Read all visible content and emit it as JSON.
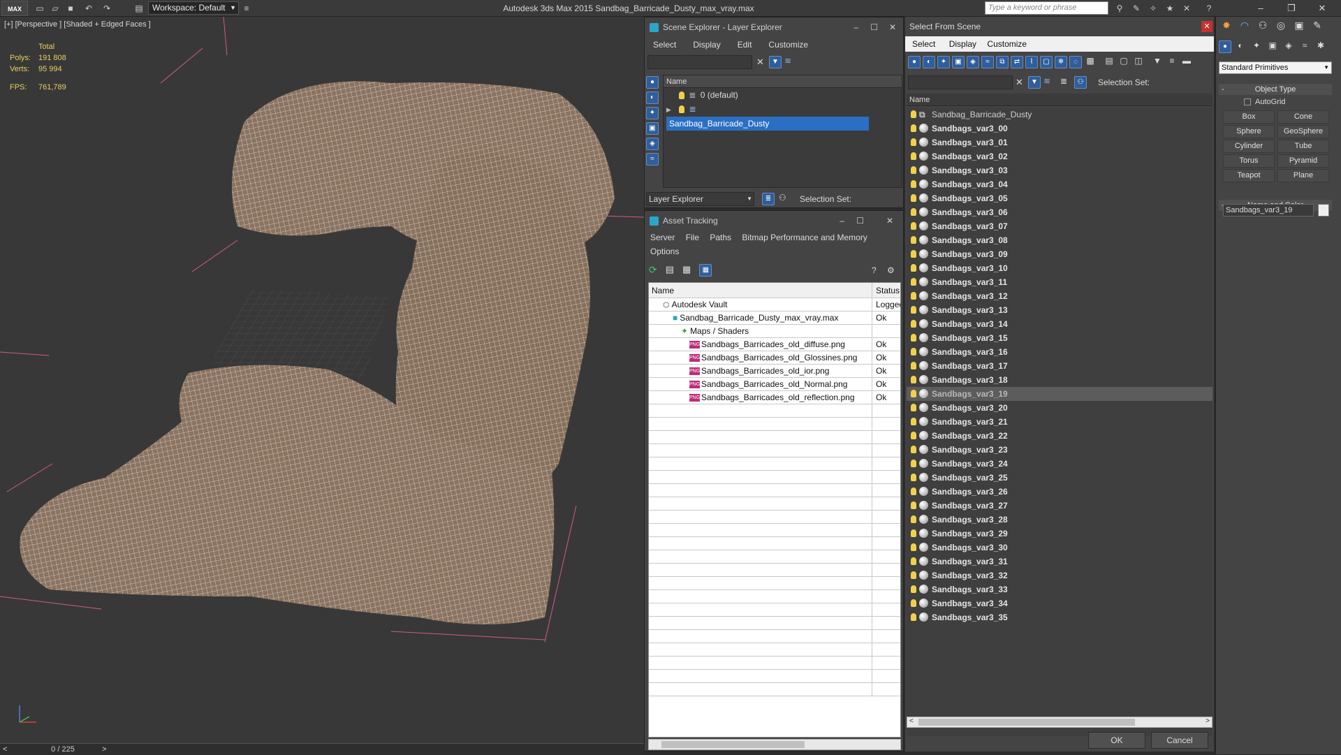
{
  "app": {
    "logo": "MAX",
    "title": "Autodesk 3ds Max  2015    Sandbag_Barricade_Dusty_max_vray.max",
    "workspace": "Workspace: Default",
    "search_placeholder": "Type a keyword or phrase"
  },
  "viewport": {
    "label": "[+] [Perspective ] [Shaded + Edged Faces ]",
    "stats": {
      "total_label": "Total",
      "polys_label": "Polys:",
      "polys": "191 808",
      "verts_label": "Verts:",
      "verts": "95 994",
      "fps_label": "FPS:",
      "fps": "761,789"
    },
    "timeline": {
      "frames": "0 / 225"
    }
  },
  "scene_explorer": {
    "title": "Scene Explorer - Layer Explorer",
    "menu": [
      "Select",
      "Display",
      "Edit",
      "Customize"
    ],
    "column_name": "Name",
    "layers": [
      "0 (default)",
      "Sandbag_Barricade_Dusty"
    ],
    "footer_label": "Layer Explorer",
    "selection_set_label": "Selection Set:"
  },
  "asset_tracking": {
    "title": "Asset Tracking",
    "menu": [
      "Server",
      "File",
      "Paths",
      "Bitmap Performance and Memory",
      "Options"
    ],
    "col_name": "Name",
    "col_status": "Status",
    "rows": [
      {
        "name": "Autodesk Vault",
        "status": "Logged",
        "indent": 0
      },
      {
        "name": "Sandbag_Barricade_Dusty_max_vray.max",
        "status": "Ok",
        "indent": 1
      },
      {
        "name": "Maps / Shaders",
        "status": "",
        "indent": 2
      },
      {
        "name": "Sandbags_Barricades_old_diffuse.png",
        "status": "Ok",
        "indent": 3
      },
      {
        "name": "Sandbags_Barricades_old_Glossines.png",
        "status": "Ok",
        "indent": 3
      },
      {
        "name": "Sandbags_Barricades_old_ior.png",
        "status": "Ok",
        "indent": 3
      },
      {
        "name": "Sandbags_Barricades_old_Normal.png",
        "status": "Ok",
        "indent": 3
      },
      {
        "name": "Sandbags_Barricades_old_reflection.png",
        "status": "Ok",
        "indent": 3
      }
    ],
    "png_tag": "PNG"
  },
  "select_from_scene": {
    "title": "Select From Scene",
    "menu": [
      "Select",
      "Display",
      "Customize"
    ],
    "selection_set_label": "Selection Set:",
    "column_name": "Name",
    "parent": "Sandbag_Barricade_Dusty",
    "objects": [
      "Sandbags_var3_00",
      "Sandbags_var3_01",
      "Sandbags_var3_02",
      "Sandbags_var3_03",
      "Sandbags_var3_04",
      "Sandbags_var3_05",
      "Sandbags_var3_06",
      "Sandbags_var3_07",
      "Sandbags_var3_08",
      "Sandbags_var3_09",
      "Sandbags_var3_10",
      "Sandbags_var3_11",
      "Sandbags_var3_12",
      "Sandbags_var3_13",
      "Sandbags_var3_14",
      "Sandbags_var3_15",
      "Sandbags_var3_16",
      "Sandbags_var3_17",
      "Sandbags_var3_18",
      "Sandbags_var3_19",
      "Sandbags_var3_20",
      "Sandbags_var3_21",
      "Sandbags_var3_22",
      "Sandbags_var3_23",
      "Sandbags_var3_24",
      "Sandbags_var3_25",
      "Sandbags_var3_26",
      "Sandbags_var3_27",
      "Sandbags_var3_28",
      "Sandbags_var3_29",
      "Sandbags_var3_30",
      "Sandbags_var3_31",
      "Sandbags_var3_32",
      "Sandbags_var3_33",
      "Sandbags_var3_34",
      "Sandbags_var3_35"
    ],
    "selected": "Sandbags_var3_19",
    "ok_label": "OK",
    "cancel_label": "Cancel"
  },
  "command_panel": {
    "category": "Standard Primitives",
    "object_type_label": "Object Type",
    "autogrid_label": "AutoGrid",
    "primitives": [
      "Box",
      "Cone",
      "Sphere",
      "GeoSphere",
      "Cylinder",
      "Tube",
      "Torus",
      "Pyramid",
      "Teapot",
      "Plane"
    ],
    "name_color_label": "Name and Color",
    "object_name": "Sandbags_var3_19"
  },
  "colors": {
    "mesh": "#8a7360",
    "wire": "#f2ece6",
    "accent": "#2a6fc4",
    "stats": "#e8d060"
  }
}
